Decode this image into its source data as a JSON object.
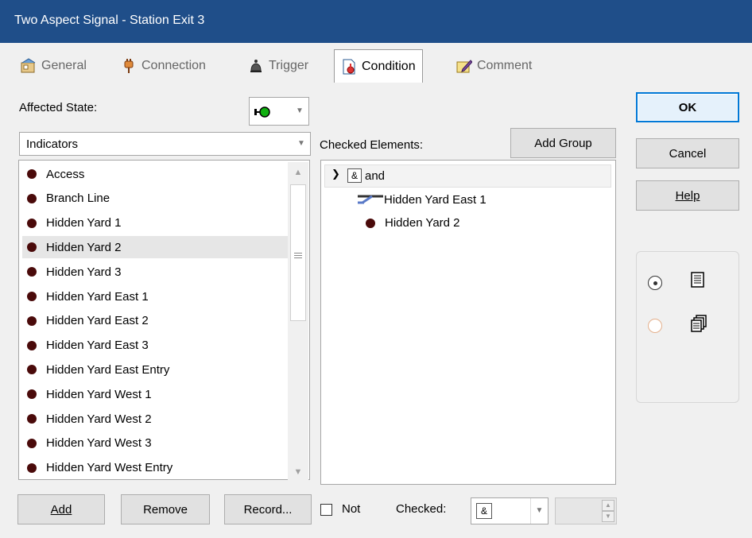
{
  "window": {
    "title": "Two Aspect Signal - Station Exit 3"
  },
  "tabs": [
    {
      "label": "General",
      "icon": "general-properties-icon"
    },
    {
      "label": "Connection",
      "icon": "plug-icon"
    },
    {
      "label": "Trigger",
      "icon": "trigger-bell-icon"
    },
    {
      "label": "Condition",
      "icon": "condition-document-icon",
      "active": true
    },
    {
      "label": "Comment",
      "icon": "comment-edit-icon"
    }
  ],
  "affected_state": {
    "label": "Affected State:",
    "icon": "green-signal-icon"
  },
  "category_combo": {
    "value": "Indicators"
  },
  "checked_elements_label": "Checked Elements:",
  "add_group_button": "Add Group",
  "indicator_list": [
    "Access",
    "Branch Line",
    "Hidden Yard 1",
    "Hidden Yard 2",
    "Hidden Yard 3",
    "Hidden Yard East 1",
    "Hidden Yard East 2",
    "Hidden Yard East 3",
    "Hidden Yard East Entry",
    "Hidden Yard West 1",
    "Hidden Yard West 2",
    "Hidden Yard West 3",
    "Hidden Yard West Entry"
  ],
  "selected_indicator": "Hidden Yard 2",
  "tree": {
    "group_symbol": "&",
    "group_label": "and",
    "children": [
      {
        "label": "Hidden Yard East 1",
        "icon": "switch-track-icon"
      },
      {
        "label": "Hidden Yard 2",
        "icon": "indicator-dot-icon"
      }
    ]
  },
  "buttons": {
    "ok": "OK",
    "cancel": "Cancel",
    "help": "Help",
    "add": "Add",
    "remove": "Remove",
    "record": "Record..."
  },
  "not_checkbox": {
    "label": "Not",
    "checked": false
  },
  "checked_combo": {
    "label": "Checked:",
    "value": "&"
  },
  "view_options": [
    {
      "icon": "list-view-icon",
      "selected": true
    },
    {
      "icon": "cascade-view-icon",
      "selected": false
    }
  ]
}
